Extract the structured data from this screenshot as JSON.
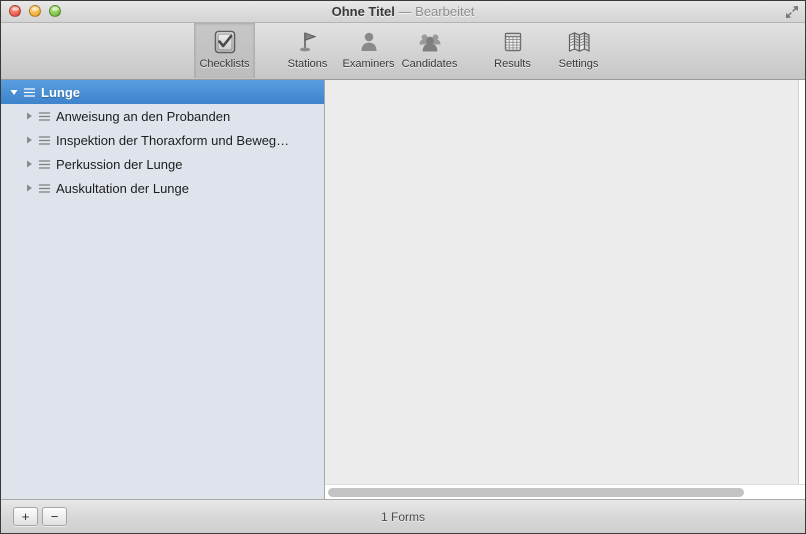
{
  "window": {
    "title": "Ohne Titel",
    "title_suffix": "— Bearbeitet",
    "traffic_lights": {
      "close": "close-button",
      "minimize": "minimize-button",
      "zoom": "zoom-button"
    },
    "fullscreen_icon": "fullscreen-icon"
  },
  "toolbar": {
    "items": [
      {
        "label": "Checklists",
        "icon": "checklist-icon",
        "selected": true
      },
      {
        "label": "Stations",
        "icon": "flag-icon",
        "selected": false
      },
      {
        "label": "Examiners",
        "icon": "person-icon",
        "selected": false
      },
      {
        "label": "Candidates",
        "icon": "people-icon",
        "selected": false
      },
      {
        "label": "Results",
        "icon": "grid-table-icon",
        "selected": false
      },
      {
        "label": "Settings",
        "icon": "folded-map-icon",
        "selected": false
      }
    ]
  },
  "sidebar": {
    "rows": [
      {
        "label": "Lunge",
        "level": 0,
        "expanded": true,
        "selected": true,
        "icon": "list-lines-icon"
      },
      {
        "label": "Anweisung an den Probanden",
        "level": 1,
        "expanded": false,
        "selected": false,
        "icon": "list-lines-icon"
      },
      {
        "label": "Inspektion der Thoraxform und Beweg…",
        "level": 1,
        "expanded": false,
        "selected": false,
        "icon": "list-lines-icon"
      },
      {
        "label": "Perkussion der Lunge",
        "level": 1,
        "expanded": false,
        "selected": false,
        "icon": "list-lines-icon"
      },
      {
        "label": "Auskultation der Lunge",
        "level": 1,
        "expanded": false,
        "selected": false,
        "icon": "list-lines-icon"
      }
    ]
  },
  "content": {
    "empty": true,
    "hscrollbar": "horizontal-scrollbar"
  },
  "bottombar": {
    "add_label": "+",
    "remove_label": "−",
    "status": "1 Forms"
  },
  "colors": {
    "selection_blue": "#3d83cc",
    "sidebar_bg": "#dfe4ec",
    "content_bg": "#ececec",
    "toolbar_bg": "#d3d3d3"
  }
}
